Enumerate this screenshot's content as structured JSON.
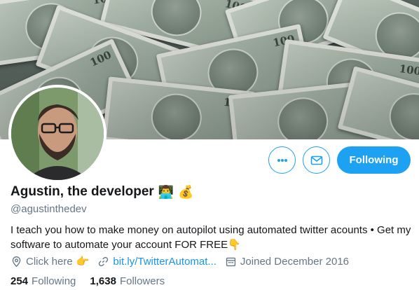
{
  "profile": {
    "display_name": "Agustin, the developer",
    "name_emojis": [
      "👨‍💻",
      "💰"
    ],
    "handle": "@agustinthedev",
    "bio": "I teach you how to make money on autopilot using automated twitter acounts •  Get my software to automate your account FOR FREE👇",
    "location": "Click here",
    "location_emoji": "👉",
    "website": "bit.ly/TwitterAutomat...",
    "joined": "Joined December 2016"
  },
  "actions": {
    "more_icon": "more-dots-icon",
    "message_icon": "envelope-icon",
    "follow_label": "Following"
  },
  "stats": {
    "following_count": "254",
    "following_label": "Following",
    "followers_count": "1,638",
    "followers_label": "Followers"
  },
  "colors": {
    "accent": "#1da1f2",
    "link": "#1b95e0",
    "muted": "#657786",
    "text": "#14171a"
  }
}
